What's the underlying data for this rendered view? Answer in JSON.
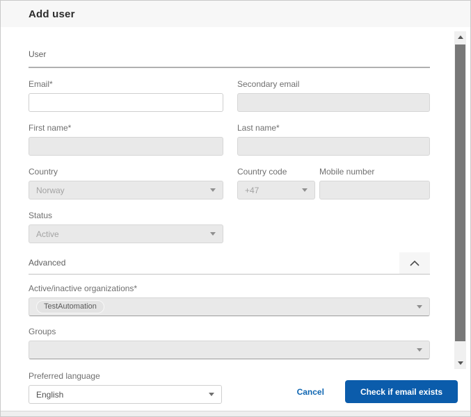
{
  "dialog": {
    "title": "Add user"
  },
  "sections": {
    "user": {
      "label": "User"
    },
    "advanced": {
      "label": "Advanced"
    }
  },
  "fields": {
    "email": {
      "label": "Email*",
      "value": ""
    },
    "secondary_email": {
      "label": "Secondary email",
      "value": ""
    },
    "first_name": {
      "label": "First name*",
      "value": ""
    },
    "last_name": {
      "label": "Last name*",
      "value": ""
    },
    "country": {
      "label": "Country",
      "value": "Norway"
    },
    "country_code": {
      "label": "Country code",
      "value": "+47"
    },
    "mobile_number": {
      "label": "Mobile number",
      "value": ""
    },
    "status": {
      "label": "Status",
      "value": "Active"
    },
    "organizations": {
      "label": "Active/inactive organizations*",
      "chips": [
        "TestAutomation"
      ]
    },
    "groups": {
      "label": "Groups",
      "value": ""
    },
    "preferred_language": {
      "label": "Preferred language",
      "value": "English"
    }
  },
  "footer": {
    "cancel_label": "Cancel",
    "submit_label": "Check if email exists"
  },
  "icons": {
    "advanced_toggle": "chevron-up-icon",
    "dropdown_caret": "caret-down-icon",
    "scroll_up": "triangle-up-icon",
    "scroll_down": "triangle-down-icon"
  },
  "colors": {
    "primary_button": "#0b5cab",
    "link": "#0f66b2",
    "header_bg": "#f7f7f7",
    "disabled_field_bg": "#e9e9e9",
    "scroll_thumb": "#787878"
  }
}
